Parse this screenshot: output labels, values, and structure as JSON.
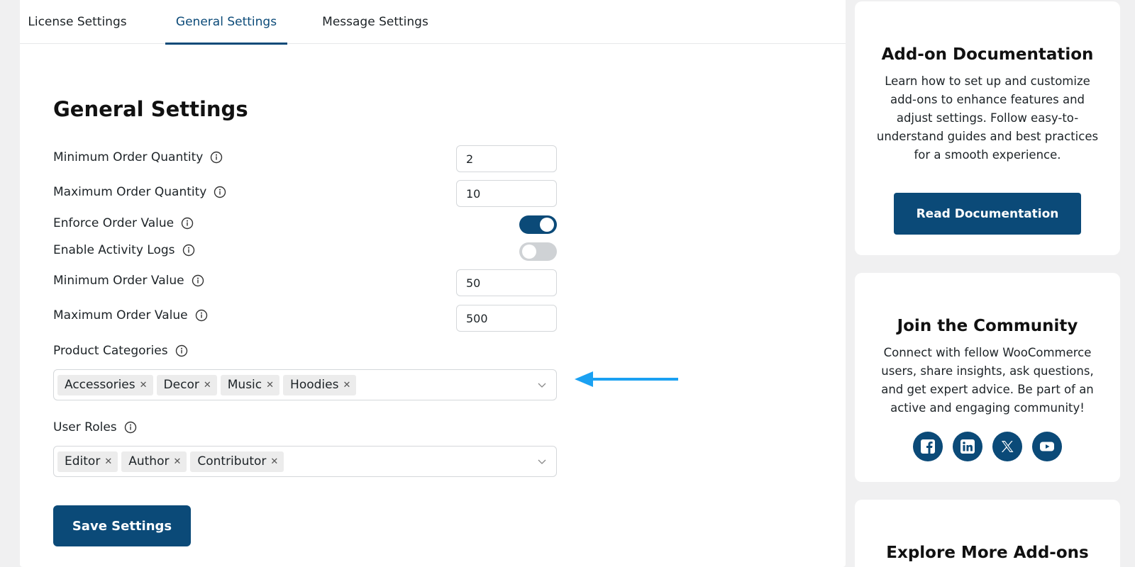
{
  "tabs": [
    {
      "label": "License Settings",
      "active": false
    },
    {
      "label": "General Settings",
      "active": true
    },
    {
      "label": "Message Settings",
      "active": false
    }
  ],
  "section_title": "General Settings",
  "fields": {
    "min_order_qty": {
      "label": "Minimum Order Quantity",
      "value": "2"
    },
    "max_order_qty": {
      "label": "Maximum Order Quantity",
      "value": "10"
    },
    "enforce_order_value": {
      "label": "Enforce Order Value",
      "enabled": true
    },
    "enable_activity_logs": {
      "label": "Enable Activity Logs",
      "enabled": false
    },
    "min_order_value": {
      "label": "Minimum Order Value",
      "value": "50"
    },
    "max_order_value": {
      "label": "Maximum Order Value",
      "value": "500"
    },
    "product_categories": {
      "label": "Product Categories",
      "selected": [
        "Accessories",
        "Decor",
        "Music",
        "Hoodies"
      ]
    },
    "user_roles": {
      "label": "User Roles",
      "selected": [
        "Editor",
        "Author",
        "Contributor"
      ]
    }
  },
  "save_label": "Save Settings",
  "sidebar": {
    "documentation": {
      "title": "Add-on Documentation",
      "text": "Learn how to set up and customize add-ons to enhance features and adjust settings. Follow easy-to-understand guides and best practices for a smooth experience.",
      "button_label": "Read Documentation"
    },
    "community": {
      "title": "Join the Community",
      "text": "Connect with fellow WooCommerce users, share insights, ask questions, and get expert advice. Be part of an active and engaging community!",
      "socials": [
        "facebook-icon",
        "linkedin-icon",
        "x-icon",
        "youtube-icon"
      ]
    },
    "explore": {
      "title": "Explore More Add-ons"
    }
  },
  "colors": {
    "primary": "#0b4a78",
    "annotation_arrow": "#1ba1f2"
  }
}
